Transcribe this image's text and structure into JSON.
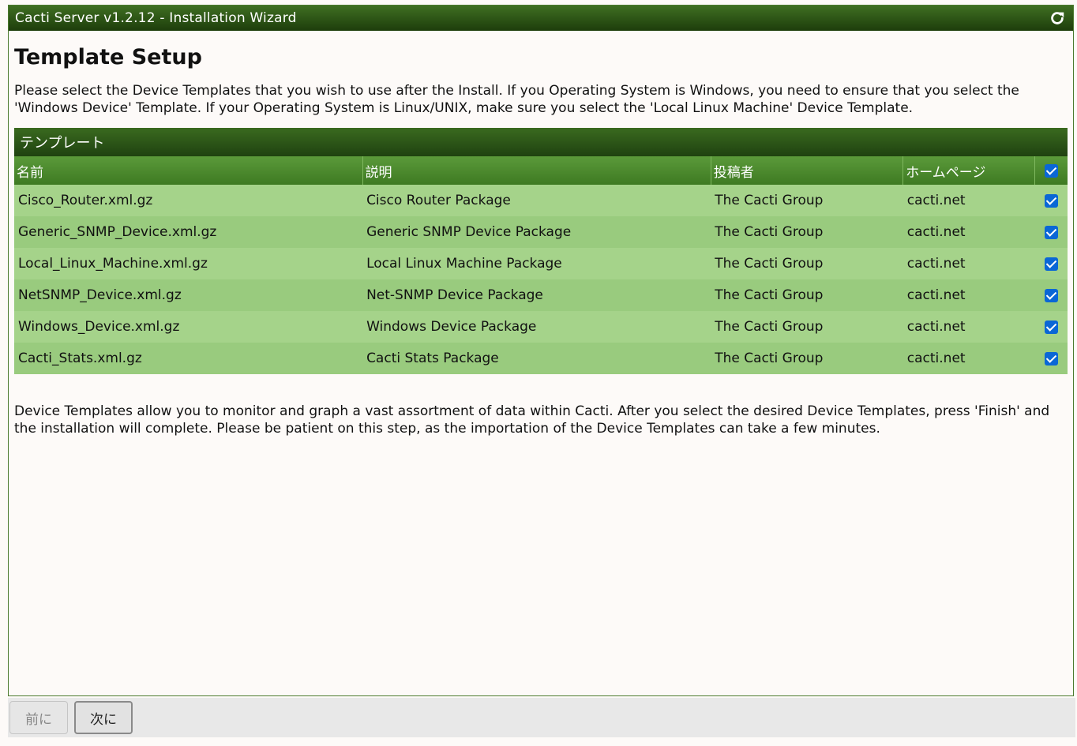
{
  "window": {
    "title": "Cacti Server v1.2.12 - Installation Wizard",
    "refresh_icon": "refresh-icon"
  },
  "page": {
    "heading": "Template Setup",
    "intro": "Please select the Device Templates that you wish to use after the Install. If you Operating System is Windows, you need to ensure that you select the 'Windows Device' Template. If your Operating System is Linux/UNIX, make sure you select the 'Local Linux Machine' Device Template.",
    "outro": "Device Templates allow you to monitor and graph a vast assortment of data within Cacti. After you select the desired Device Templates, press 'Finish' and the installation will complete. Please be patient on this step, as the importation of the Device Templates can take a few minutes."
  },
  "table": {
    "section_title": "テンプレート",
    "columns": [
      "名前",
      "説明",
      "投稿者",
      "ホームページ"
    ],
    "select_all_checked": true,
    "rows": [
      {
        "name": "Cisco_Router.xml.gz",
        "description": "Cisco Router Package",
        "author": "The Cacti Group",
        "homepage": "cacti.net",
        "checked": true
      },
      {
        "name": "Generic_SNMP_Device.xml.gz",
        "description": "Generic SNMP Device Package",
        "author": "The Cacti Group",
        "homepage": "cacti.net",
        "checked": true
      },
      {
        "name": "Local_Linux_Machine.xml.gz",
        "description": "Local Linux Machine Package",
        "author": "The Cacti Group",
        "homepage": "cacti.net",
        "checked": true
      },
      {
        "name": "NetSNMP_Device.xml.gz",
        "description": "Net-SNMP Device Package",
        "author": "The Cacti Group",
        "homepage": "cacti.net",
        "checked": true
      },
      {
        "name": "Windows_Device.xml.gz",
        "description": "Windows Device Package",
        "author": "The Cacti Group",
        "homepage": "cacti.net",
        "checked": true
      },
      {
        "name": "Cacti_Stats.xml.gz",
        "description": "Cacti Stats Package",
        "author": "The Cacti Group",
        "homepage": "cacti.net",
        "checked": true
      }
    ]
  },
  "buttons": {
    "prev_label": "前に",
    "next_label": "次に"
  },
  "colors": {
    "header_dark": "#1d3d0b",
    "header_green": "#3e7a22",
    "row_green": "#a5d38a",
    "checkbox_blue": "#0a67d6"
  }
}
